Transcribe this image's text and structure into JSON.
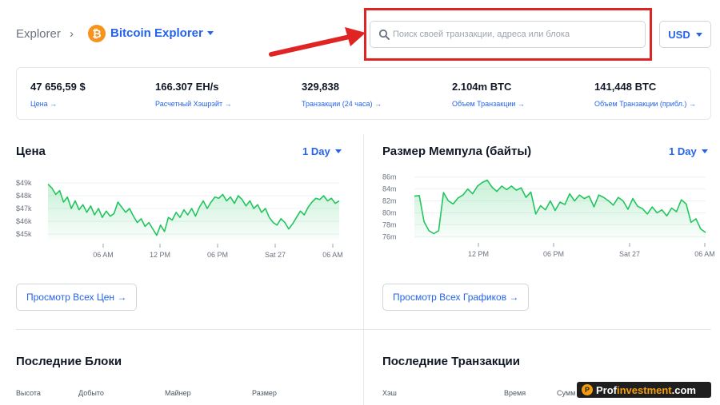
{
  "header": {
    "breadcrumb_root": "Explorer",
    "breadcrumb_sep": "›",
    "explorer_name": "Bitcoin Explorer",
    "btc_symbol": "₿",
    "search_placeholder": "Поиск своей транзакции, адреса или блока",
    "currency": "USD"
  },
  "stats": [
    {
      "value": "47 656,59 $",
      "label": "Цена →"
    },
    {
      "value": "166.307 EH/s",
      "label": "Расчетный Хэшрэйт →"
    },
    {
      "value": "329,838",
      "label": "Транзакции (24 часа) →"
    },
    {
      "value": "2.104m BTC",
      "label": "Объем Транзакции →"
    },
    {
      "value": "141,448 BTC",
      "label": "Объем Транзакции (прибл.) →"
    }
  ],
  "price_panel": {
    "title": "Цена",
    "range": "1 Day",
    "button": "Просмотр Всех Цен →",
    "y_ticks": [
      "$49k",
      "$48k",
      "$47k",
      "$46k",
      "$45k"
    ],
    "x_ticks": [
      "06 AM",
      "12 PM",
      "06 PM",
      "Sat 27",
      "06 AM"
    ]
  },
  "mempool_panel": {
    "title": "Размер Мемпула (байты)",
    "range": "1 Day",
    "button": "Просмотр Всех Графиков →",
    "y_ticks": [
      "86m",
      "84m",
      "82m",
      "80m",
      "78m",
      "76m"
    ],
    "x_ticks": [
      "12 PM",
      "06 PM",
      "Sat 27",
      "06 AM"
    ]
  },
  "blocks": {
    "title": "Последние Блоки",
    "columns": [
      "Высота",
      "Добыто",
      "Майнер",
      "Размер"
    ]
  },
  "transactions": {
    "title": "Последние Транзакции",
    "columns": [
      "Хэш",
      "Время",
      "Сумм"
    ]
  },
  "watermark": {
    "part1": "Prof",
    "part2": "investment",
    "part3": ".com",
    "logo": "P"
  },
  "colors": {
    "accent": "#2563eb",
    "chart_line": "#22c55e",
    "bitcoin": "#f7931a",
    "highlight": "#e02424"
  },
  "chart_data": [
    {
      "type": "area",
      "title": "Цена",
      "ylabel": "",
      "xlabel": "",
      "ylim": [
        44.5,
        49.5
      ],
      "y_unit": "$k",
      "x_ticks": [
        "06 AM",
        "12 PM",
        "06 PM",
        "Sat 27",
        "06 AM"
      ],
      "values": [
        48.9,
        48.6,
        48.1,
        48.4,
        47.5,
        47.9,
        47.0,
        47.6,
        46.9,
        47.3,
        46.7,
        47.2,
        46.5,
        47.0,
        46.3,
        46.8,
        46.4,
        46.6,
        47.5,
        47.1,
        46.7,
        47.0,
        46.4,
        45.9,
        46.2,
        45.6,
        45.9,
        45.4,
        44.9,
        45.7,
        45.2,
        46.3,
        46.1,
        46.7,
        46.3,
        46.9,
        46.5,
        47.0,
        46.4,
        47.1,
        47.6,
        47.0,
        47.5,
        47.9,
        47.8,
        48.1,
        47.6,
        47.9,
        47.4,
        48.0,
        47.7,
        47.2,
        47.6,
        47.0,
        47.3,
        46.7,
        47.0,
        46.3,
        45.9,
        45.7,
        46.2,
        45.9,
        45.4,
        45.8,
        46.3,
        46.8,
        46.5,
        47.1,
        47.5,
        47.8,
        47.7,
        48.0,
        47.6,
        47.8,
        47.4,
        47.6
      ]
    },
    {
      "type": "area",
      "title": "Размер Мемпула (байты)",
      "ylabel": "",
      "xlabel": "",
      "ylim": [
        75.5,
        86.5
      ],
      "y_unit": "m",
      "x_ticks": [
        "12 PM",
        "06 PM",
        "Sat 27",
        "06 AM"
      ],
      "values": [
        82.8,
        82.9,
        78.5,
        77.0,
        76.5,
        77.0,
        83.4,
        82.0,
        81.5,
        82.5,
        83.0,
        84.0,
        83.2,
        84.5,
        85.1,
        85.5,
        84.3,
        83.6,
        84.5,
        83.9,
        84.5,
        83.8,
        84.2,
        82.6,
        83.5,
        79.8,
        81.2,
        80.5,
        82.0,
        80.4,
        81.8,
        81.4,
        83.2,
        82.0,
        83.0,
        82.4,
        82.8,
        81.0,
        83.0,
        82.6,
        82.0,
        81.3,
        82.6,
        82.0,
        80.6,
        82.4,
        81.1,
        80.7,
        79.8,
        81.0,
        80.0,
        80.5,
        79.5,
        80.8,
        80.2,
        82.2,
        81.5,
        78.4,
        79.0,
        77.3,
        76.7
      ]
    }
  ]
}
